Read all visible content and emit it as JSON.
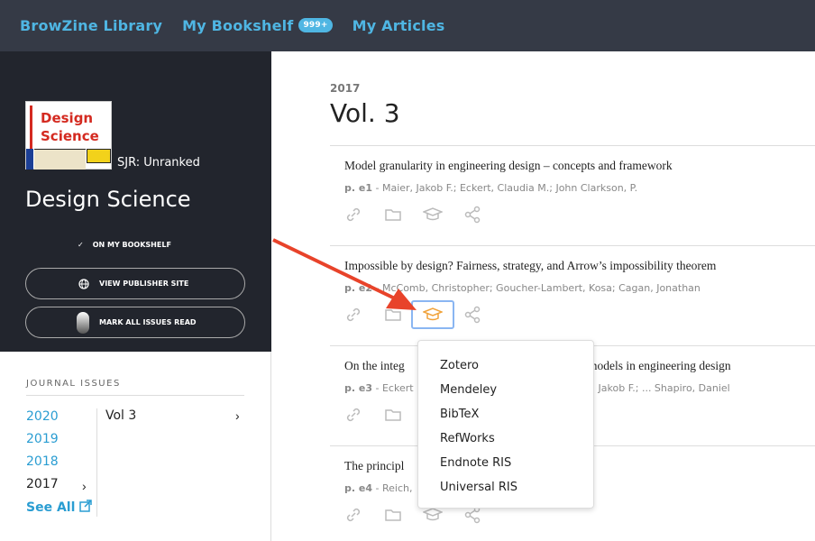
{
  "topbar": {
    "library_label": "BrowZine Library",
    "bookshelf_label": "My Bookshelf",
    "bookshelf_badge": "999+",
    "articles_label": "My Articles",
    "link_color": "#4fb6e3",
    "background": "#353a46"
  },
  "journal": {
    "cover_title_line1": "Design",
    "cover_title_line2": "Science",
    "sjr": "SJR: Unranked",
    "title": "Design Science",
    "on_bookshelf": "ON MY BOOKSHELF",
    "view_publisher": "VIEW PUBLISHER SITE",
    "mark_read": "MARK ALL ISSUES READ"
  },
  "issues": {
    "heading": "JOURNAL ISSUES",
    "years": [
      "2020",
      "2019",
      "2018",
      "2017"
    ],
    "selected_year": "2017",
    "see_all": "See All",
    "volumes": [
      "Vol 3"
    ]
  },
  "main": {
    "year": "2017",
    "volume_title": "Vol. 3",
    "articles": [
      {
        "title": "Model granularity in engineering design – concepts and framework",
        "page": "p. e1",
        "authors": "Maier, Jakob F.; Eckert, Claudia M.; John Clarkson, P."
      },
      {
        "title": "Impossible by design? Fairness, strategy, and Arrow’s impossibility theorem",
        "page": "p. e2",
        "authors": "McComb, Christopher; Goucher-Lambert, Kosa; Cagan, Jonathan"
      },
      {
        "title": "On the integ",
        "title_tail": "models in engineering design",
        "page": "p. e3",
        "authors": "Eckert",
        "authors_tail": "r, Jakob F.; ... Shapiro, Daniel"
      },
      {
        "title": "The principl",
        "page": "p. e4",
        "authors": "Reich,"
      }
    ]
  },
  "citation_menu": {
    "items": [
      "Zotero",
      "Mendeley",
      "BibTeX",
      "RefWorks",
      "Endnote RIS",
      "Universal RIS"
    ],
    "active_icon_color": "#f0a23a"
  },
  "annotation": {
    "arrow_color": "#e8432a"
  }
}
